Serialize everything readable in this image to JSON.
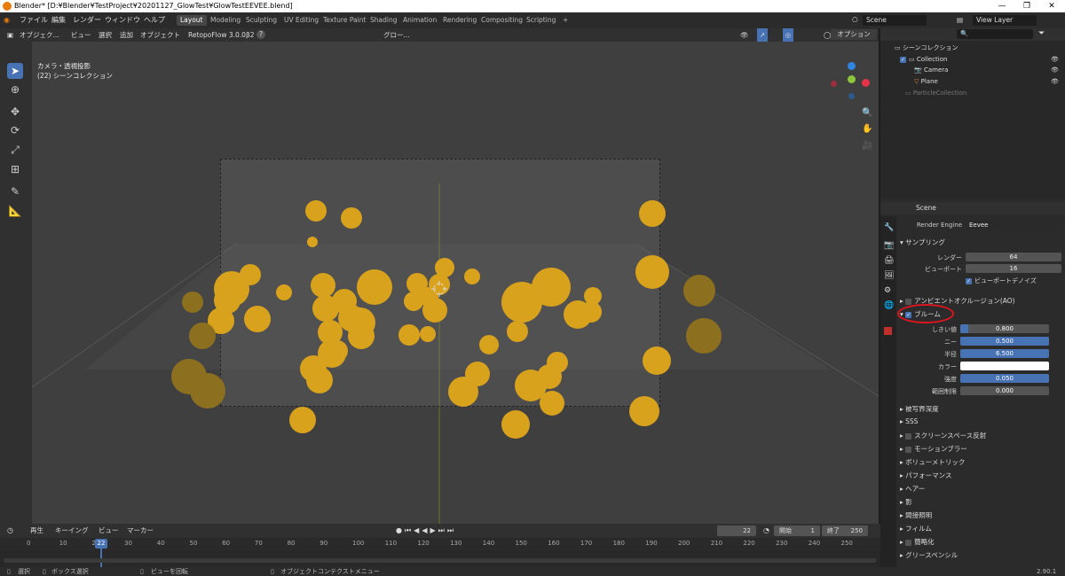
{
  "window": {
    "title": "Blender* [D:¥Blender¥TestProject¥20201127_GlowTest¥GlowTestEEVEE.blend]",
    "min": "—",
    "max": "❐",
    "close": "✕"
  },
  "menu": {
    "items": [
      "ファイル",
      "編集",
      "レンダー",
      "ウィンドウ",
      "ヘルプ"
    ]
  },
  "workspaces": {
    "tabs": [
      "Layout",
      "Modeling",
      "Sculpting",
      "UV Editing",
      "Texture Paint",
      "Shading",
      "Animation",
      "Rendering",
      "Compositing",
      "Scripting"
    ],
    "add": "+"
  },
  "scene_selector": {
    "scene": "Scene",
    "view_layer": "View Layer"
  },
  "viewport_header": {
    "mode": "オブジェク...",
    "view": "ビュー",
    "select": "選択",
    "add": "追加",
    "object": "オブジェクト",
    "addon": "RetopoFlow 3.0.0β2",
    "help": "?",
    "transform": "グロー...",
    "options": "オプション"
  },
  "viewport": {
    "camera_label": "カメラ・透視投影",
    "collection_label": "(22) シーンコレクション",
    "gizmo_colors": {
      "x": "#e5344a",
      "y": "#8ac73b",
      "z": "#2f86e0"
    }
  },
  "outliner": {
    "title": "シーンコレクション",
    "rows": [
      {
        "label": "Collection",
        "icon": "collection-icon"
      },
      {
        "label": "Camera",
        "icon": "camera-icon"
      },
      {
        "label": "Plane",
        "icon": "mesh-icon"
      },
      {
        "label": "ParticleCollection",
        "icon": "collection-icon"
      }
    ]
  },
  "properties": {
    "scene_label": "Scene",
    "render_engine_label": "Render Engine",
    "render_engine": "Eevee",
    "sampling": {
      "title": "サンプリング",
      "render_label": "レンダー",
      "render": "64",
      "viewport_label": "ビューポート",
      "viewport": "16",
      "denoise": "ビューポートデノイズ"
    },
    "ao": "アンビエントオクルージョン(AO)",
    "bloom": {
      "title": "ブルーム",
      "threshold_label": "しきい値",
      "threshold": "0.800",
      "threshold_fill": 0.09,
      "knee_label": "ニー",
      "knee": "0.500",
      "knee_fill": 1.0,
      "radius_label": "半径",
      "radius": "6.500",
      "radius_fill": 1.0,
      "color_label": "カラー",
      "color": "#ffffff",
      "intensity_label": "強度",
      "intensity": "0.050",
      "intensity_fill": 1.0,
      "clamp_label": "範囲制限",
      "clamp": "0.000"
    },
    "sections": [
      "被写界深度",
      "SSS",
      "スクリーンスペース反射",
      "モーションブラー",
      "ボリューメトリック",
      "パフォーマンス",
      "ヘアー",
      "影",
      "間接照明",
      "フィルム",
      "簡略化",
      "グリースペンシル"
    ],
    "section_checkbox": [
      false,
      false,
      true,
      true,
      false,
      false,
      false,
      false,
      false,
      false,
      true,
      false
    ]
  },
  "timeline": {
    "menu": [
      "再生",
      "キーイング",
      "ビュー",
      "マーカー"
    ],
    "current_frame": "22",
    "start_label": "開始",
    "start": "1",
    "end_label": "終了",
    "end": "250",
    "ticks": [
      "0",
      "10",
      "20",
      "30",
      "40",
      "50",
      "60",
      "70",
      "80",
      "90",
      "100",
      "110",
      "120",
      "130",
      "140",
      "150",
      "160",
      "170",
      "180",
      "190",
      "200",
      "210",
      "220",
      "230",
      "240",
      "250"
    ]
  },
  "status": {
    "select": "選択",
    "box_select": "ボックス選択",
    "rotate": "ビューを回転",
    "context": "オブジェクトコンテクストメニュー",
    "version": "2.90.1"
  },
  "accent_color": "#4772b3",
  "orb_color": "#d9a21c"
}
